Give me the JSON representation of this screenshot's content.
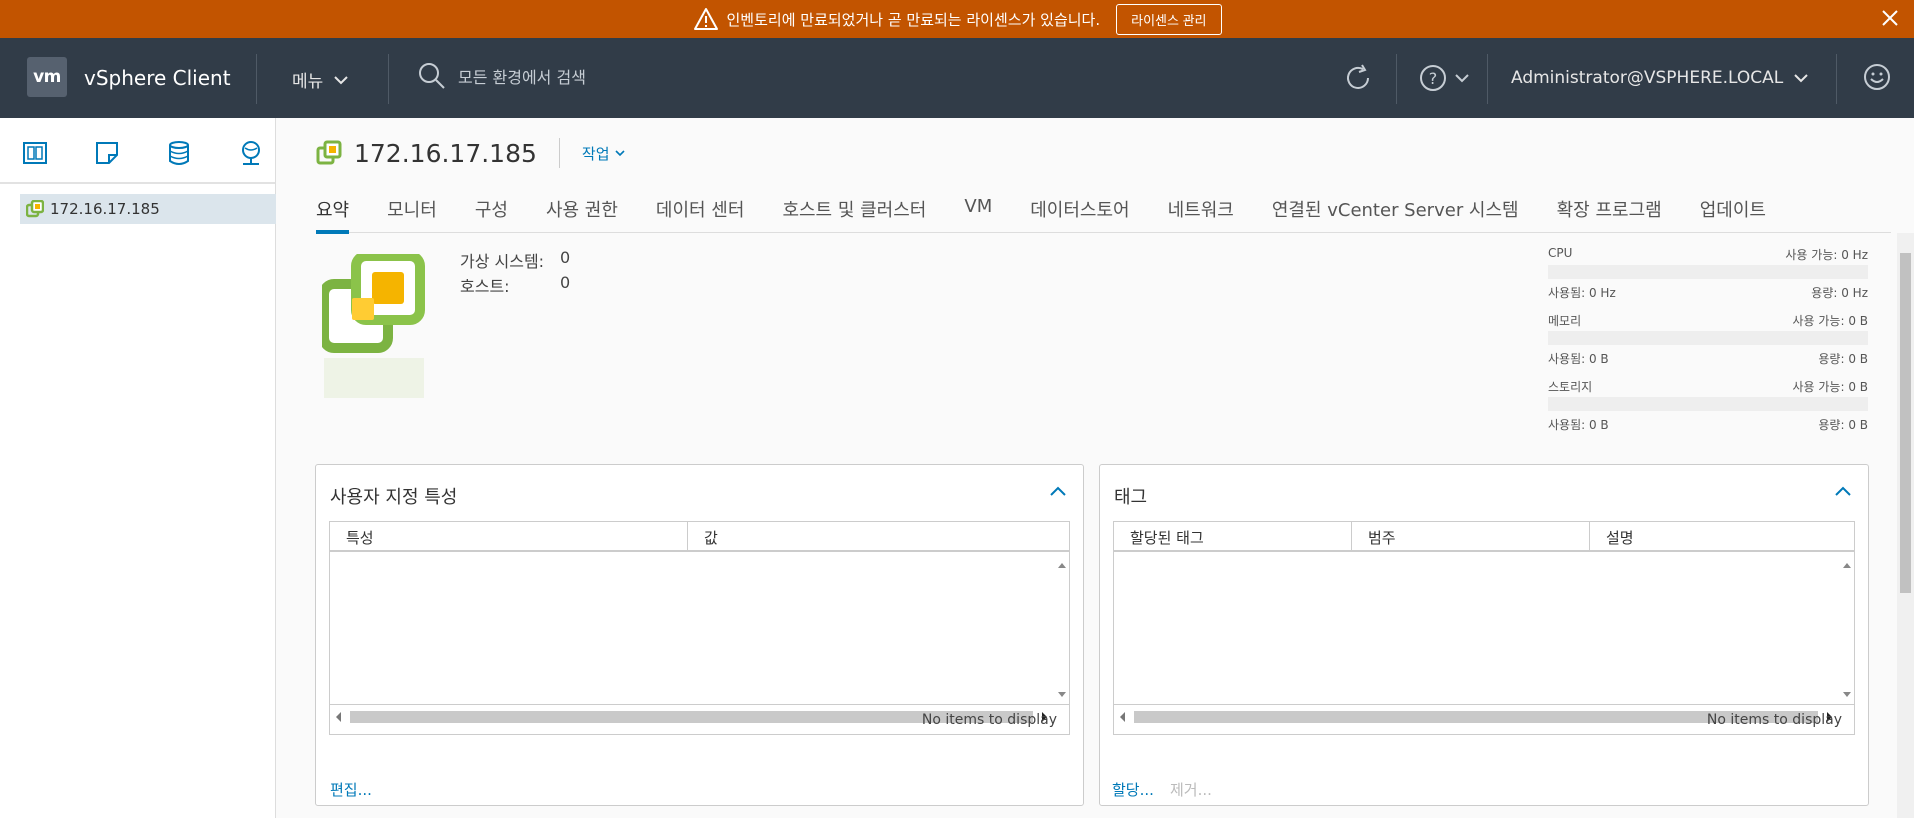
{
  "banner": {
    "message": "인벤토리에 만료되었거나 곧 만료되는 라이센스가 있습니다.",
    "button": "라이센스 관리"
  },
  "header": {
    "logo": "vm",
    "title": "vSphere Client",
    "menu": "메뉴",
    "search_placeholder": "모든 환경에서 검색",
    "user": "Administrator@VSPHERE.LOCAL"
  },
  "sidebar": {
    "tree_item": "172.16.17.185"
  },
  "object": {
    "title": "172.16.17.185",
    "actions": "작업"
  },
  "tabs": [
    "요약",
    "모니터",
    "구성",
    "사용 권한",
    "데이터 센터",
    "호스트 및 클러스터",
    "VM",
    "데이터스토어",
    "네트워크",
    "연결된 vCenter Server 시스템",
    "확장 프로그램",
    "업데이트"
  ],
  "summary": {
    "vm_label": "가상 시스템:",
    "vm_value": "0",
    "host_label": "호스트:",
    "host_value": "0"
  },
  "resources": [
    {
      "name": "CPU",
      "free": "사용 가능: 0 Hz",
      "used": "사용됨: 0 Hz",
      "capacity": "용량: 0 Hz"
    },
    {
      "name": "메모리",
      "free": "사용 가능: 0 B",
      "used": "사용됨: 0 B",
      "capacity": "용량: 0 B"
    },
    {
      "name": "스토리지",
      "free": "사용 가능: 0 B",
      "used": "사용됨: 0 B",
      "capacity": "용량: 0 B"
    }
  ],
  "custom_attributes": {
    "title": "사용자 지정 특성",
    "columns": [
      "특성",
      "값"
    ],
    "empty": "No items to display",
    "edit_link": "편집..."
  },
  "tags": {
    "title": "태그",
    "columns": [
      "할당된 태그",
      "범주",
      "설명"
    ],
    "empty": "No items to display",
    "assign_link": "할당...",
    "remove_link": "제거..."
  },
  "colors": {
    "banner": "#c25400",
    "header": "#313c48",
    "accent": "#0079b8",
    "icon_green": "#7cb342",
    "icon_yellow": "#f5b400"
  }
}
